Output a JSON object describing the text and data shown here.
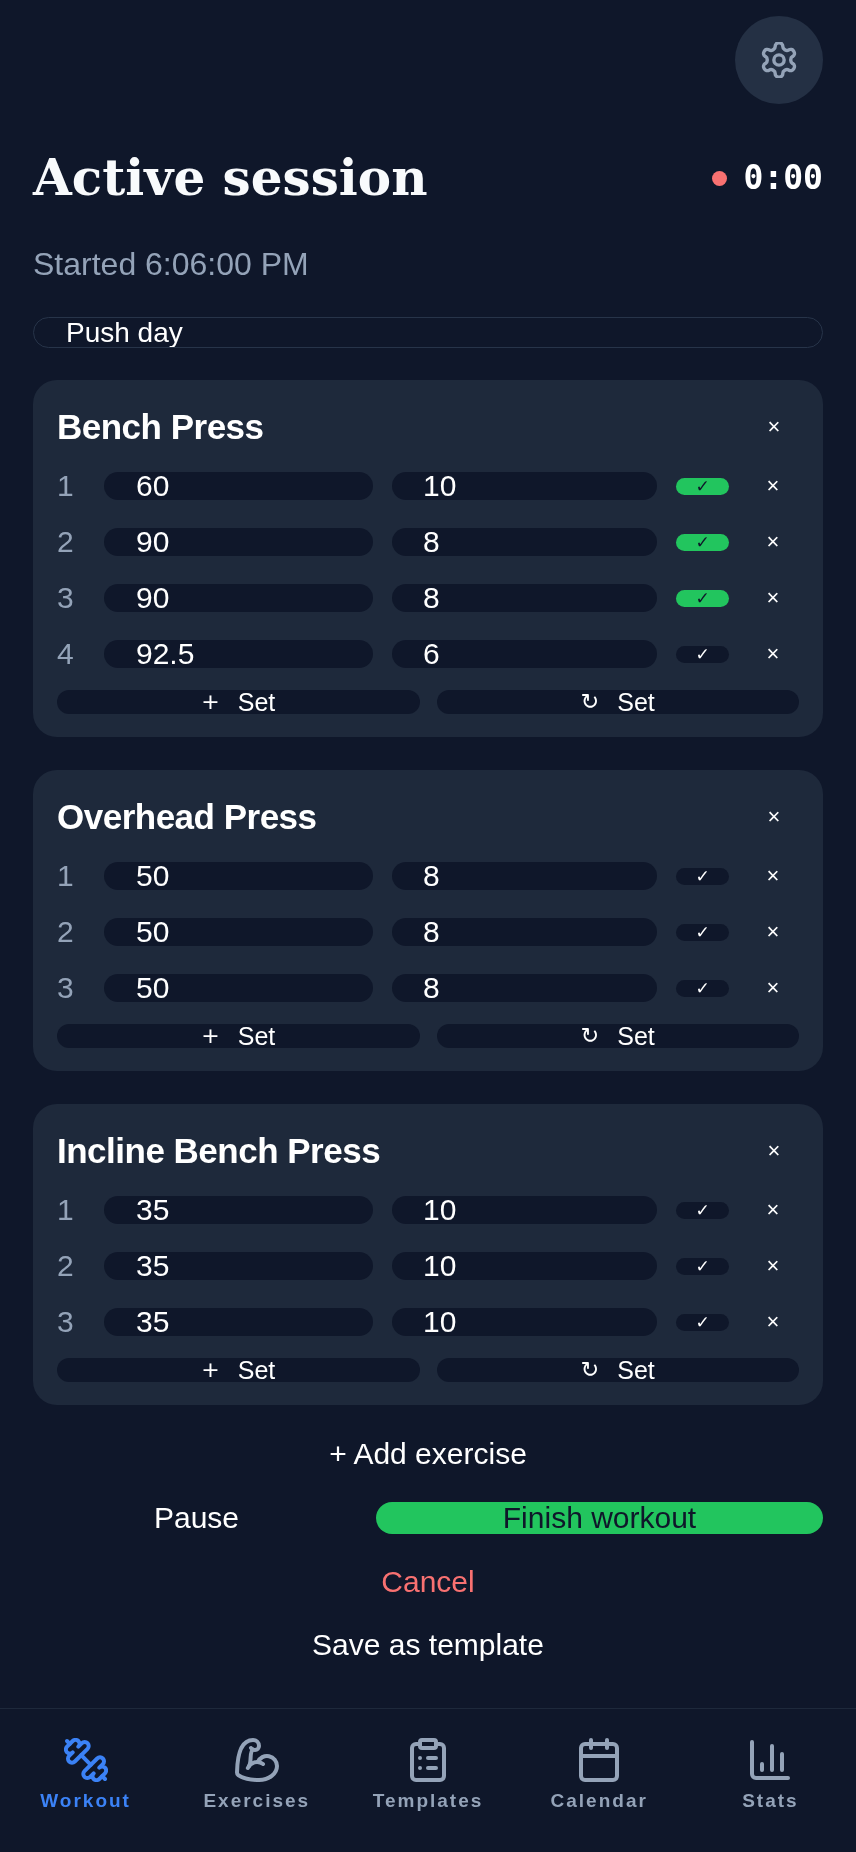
{
  "header": {
    "title": "Active session",
    "running": true,
    "timer": "0:00",
    "started": "Started 6:06:00 PM"
  },
  "workout_name": {
    "value": "Push day"
  },
  "exercises": [
    {
      "name": "Bench Press",
      "remove": "×",
      "sets": [
        {
          "number": "1",
          "weight": "60",
          "reps": "10",
          "check": "✓",
          "done": true,
          "remove": "×"
        },
        {
          "number": "2",
          "weight": "90",
          "reps": "8",
          "check": "✓",
          "done": true,
          "remove": "×"
        },
        {
          "number": "3",
          "weight": "90",
          "reps": "8",
          "check": "✓",
          "done": true,
          "remove": "×"
        },
        {
          "number": "4",
          "weight": "92.5",
          "reps": "6",
          "check": "✓",
          "done": false,
          "remove": "×"
        }
      ],
      "add_set": {
        "icon": "+",
        "label": "Set"
      },
      "repeat_set": {
        "icon": "↻",
        "label": "Set"
      }
    },
    {
      "name": "Overhead Press",
      "remove": "×",
      "sets": [
        {
          "number": "1",
          "weight": "50",
          "reps": "8",
          "check": "✓",
          "done": false,
          "remove": "×"
        },
        {
          "number": "2",
          "weight": "50",
          "reps": "8",
          "check": "✓",
          "done": false,
          "remove": "×"
        },
        {
          "number": "3",
          "weight": "50",
          "reps": "8",
          "check": "✓",
          "done": false,
          "remove": "×"
        }
      ],
      "add_set": {
        "icon": "+",
        "label": "Set"
      },
      "repeat_set": {
        "icon": "↻",
        "label": "Set"
      }
    },
    {
      "name": "Incline Bench Press",
      "remove": "×",
      "sets": [
        {
          "number": "1",
          "weight": "35",
          "reps": "10",
          "check": "✓",
          "done": false,
          "remove": "×"
        },
        {
          "number": "2",
          "weight": "35",
          "reps": "10",
          "check": "✓",
          "done": false,
          "remove": "×"
        },
        {
          "number": "3",
          "weight": "35",
          "reps": "10",
          "check": "✓",
          "done": false,
          "remove": "×"
        }
      ],
      "add_set": {
        "icon": "+",
        "label": "Set"
      },
      "repeat_set": {
        "icon": "↻",
        "label": "Set"
      }
    }
  ],
  "actions": {
    "add_exercise": "+ Add exercise",
    "pause": "Pause",
    "finish": "Finish workout",
    "cancel": "Cancel",
    "save_template": "Save as template"
  },
  "nav": [
    {
      "label": "Workout",
      "selected": true
    },
    {
      "label": "Exercises",
      "selected": false
    },
    {
      "label": "Templates",
      "selected": false
    },
    {
      "label": "Calendar",
      "selected": false
    },
    {
      "label": "Stats",
      "selected": false
    }
  ]
}
